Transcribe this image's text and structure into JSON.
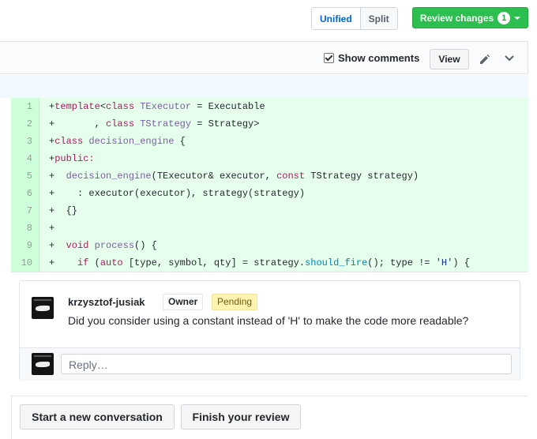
{
  "toolbar": {
    "unified_label": "Unified",
    "split_label": "Split",
    "review_label": "Review changes",
    "review_count": "1"
  },
  "file_header": {
    "show_comments_label": "Show comments",
    "show_comments_checked": true,
    "view_label": "View",
    "icons": [
      "pencil-icon",
      "chevron-down-icon"
    ]
  },
  "diff": {
    "lines": [
      {
        "num": "1",
        "text": "+template<class TExecutor = Executable"
      },
      {
        "num": "2",
        "text": "+       , class TStrategy = Strategy>"
      },
      {
        "num": "3",
        "text": "+class decision_engine {"
      },
      {
        "num": "4",
        "text": "+public:"
      },
      {
        "num": "5",
        "text": "+  decision_engine(TExecutor& executor, const TStrategy strategy)"
      },
      {
        "num": "6",
        "text": "+    : executor(executor), strategy(strategy)"
      },
      {
        "num": "7",
        "text": "+  {}"
      },
      {
        "num": "8",
        "text": "+"
      },
      {
        "num": "9",
        "text": "+  void process() {"
      },
      {
        "num": "10",
        "text": "+    if (auto [type, symbol, qty] = strategy.should_fire(); type != 'H') {"
      }
    ]
  },
  "comment": {
    "author": "krzysztof-jusiak",
    "owner_badge": "Owner",
    "pending_badge": "Pending",
    "body": "Did you consider using a constant instead of 'H' to make the code more readable?",
    "reply_placeholder": "Reply…"
  },
  "actions": {
    "new_conversation_label": "Start a new conversation",
    "finish_review_label": "Finish your review"
  },
  "colors": {
    "added_line_bg": "#e6ffed",
    "added_num_bg": "#cdffd8",
    "primary_green": "#2cbe4e",
    "link_blue": "#0366d6",
    "pending_bg": "#fff5b1"
  }
}
